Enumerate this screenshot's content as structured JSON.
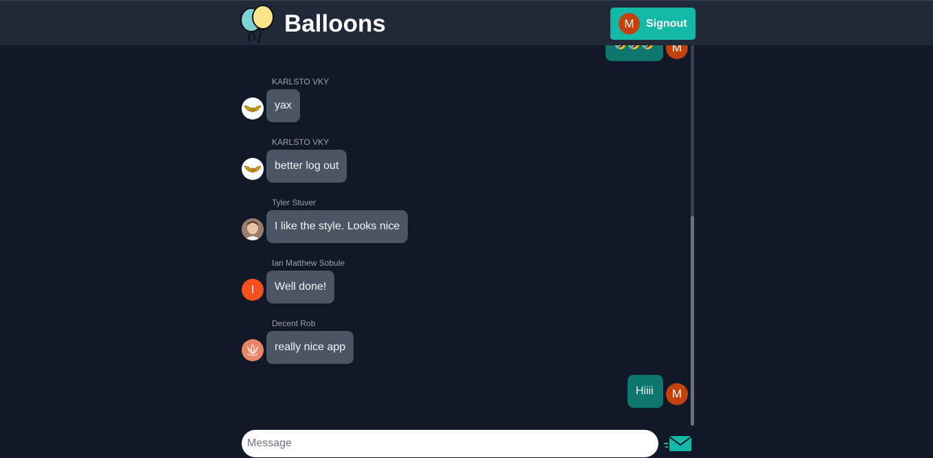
{
  "header": {
    "title": "Balloons",
    "signout_label": "Signout",
    "user_initial": "M"
  },
  "messages": [
    {
      "type": "outgoing",
      "text": "🤣🤣🤣",
      "avatar_initial": "M"
    },
    {
      "type": "incoming",
      "sender": "KARLSTO VKY",
      "text": "yax",
      "avatar": "golden-wings-icon"
    },
    {
      "type": "incoming",
      "sender": "KARLSTO VKY",
      "text": "better log out",
      "avatar": "golden-wings-icon"
    },
    {
      "type": "incoming",
      "sender": "Tyler Stuver",
      "text": "I like the style. Looks nice",
      "avatar": "user-photo"
    },
    {
      "type": "incoming",
      "sender": "Ian Matthew Sobule",
      "text": "Well done!",
      "avatar_initial": "I"
    },
    {
      "type": "incoming",
      "sender": "Decent Rob",
      "text": "really nice app",
      "avatar": "lotus-icon"
    },
    {
      "type": "outgoing",
      "text": "Hiiii",
      "avatar_initial": "M"
    }
  ],
  "composer": {
    "placeholder": "Message",
    "value": ""
  },
  "colors": {
    "background": "#111827",
    "header": "#1f2937",
    "accent": "#14b8a6",
    "outgoing_bubble": "#0f766e",
    "incoming_bubble": "#4b5563"
  }
}
